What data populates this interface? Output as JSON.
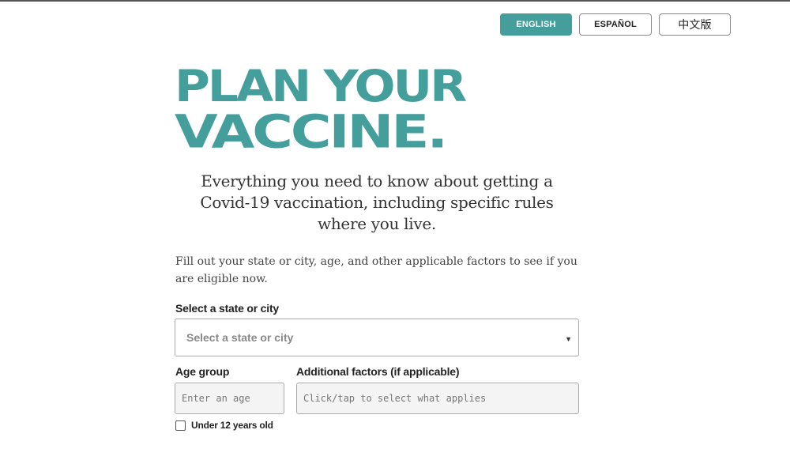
{
  "languages": [
    {
      "label": "ENGLISH",
      "active": true
    },
    {
      "label": "ESPAÑOL",
      "active": false
    },
    {
      "label": "中文版",
      "active": false
    }
  ],
  "headline": {
    "line1": "PLAN YOUR",
    "line2": "VACCINE."
  },
  "subhead": "Everything you need to know about getting a Covid-19 vaccination, including specific rules where you live.",
  "intro": "Fill out your state or city, age, and other applicable factors to see if you are eligible now.",
  "form": {
    "state_label": "Select a state or city",
    "state_placeholder": "Select a state or city",
    "state_caret": "▼",
    "age_label": "Age group",
    "age_placeholder": "Enter an age",
    "factors_label": "Additional factors (if applicable)",
    "factors_placeholder": "Click/tap to select what applies",
    "under12_label": "Under 12 years old"
  },
  "colors": {
    "accent": "#439e9c"
  }
}
